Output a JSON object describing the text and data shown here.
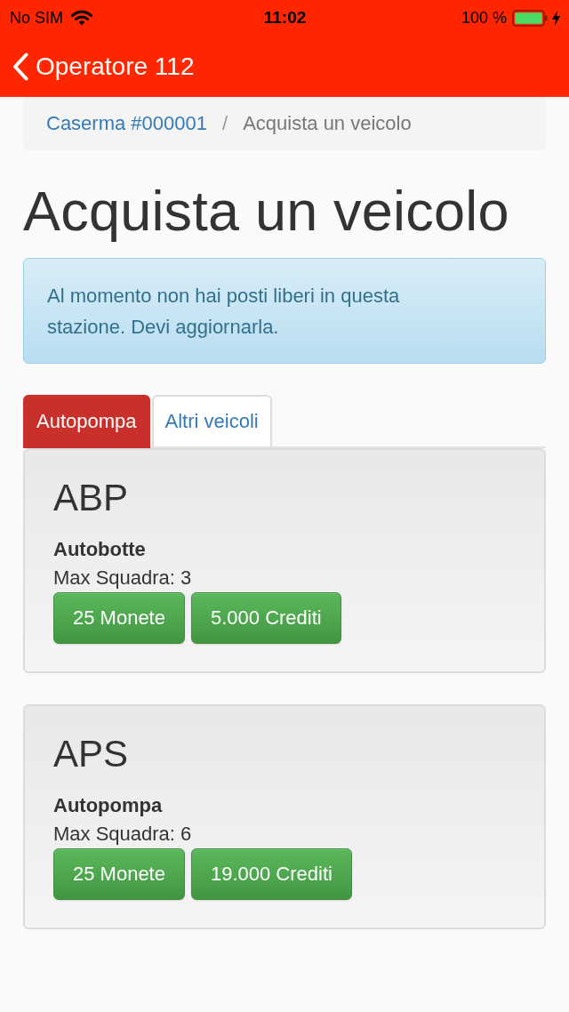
{
  "status_bar": {
    "carrier": "No SIM",
    "time": "11:02",
    "battery": "100 %",
    "charging": true
  },
  "nav_bar": {
    "back_label": "Operatore 112"
  },
  "breadcrumb": {
    "separator": "/",
    "items": [
      {
        "label": "Caserma #000001",
        "kind": "link"
      },
      {
        "label": "Acquista un veicolo",
        "kind": "current"
      }
    ]
  },
  "title": "Acquista un veicolo",
  "alert": "Al momento non hai posti liberi in questa stazione. Devi aggiornarla.",
  "tabs": [
    {
      "label": "Autopompa",
      "selected": true
    },
    {
      "label": "Altri veicoli",
      "selected": false
    }
  ],
  "vehicles": [
    {
      "code": "ABP",
      "name": "Autobotte",
      "crew": "Max Squadra: 3",
      "buttons": [
        "25 Monete",
        "5.000 Crediti"
      ]
    },
    {
      "code": "APS",
      "name": "Autopompa",
      "crew": "Max Squadra: 6",
      "buttons": [
        "25 Monete",
        "19.000 Crediti"
      ]
    }
  ]
}
